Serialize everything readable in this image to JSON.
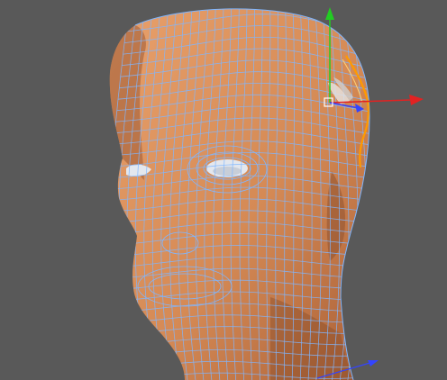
{
  "viewport": {
    "background_color": "#595959"
  },
  "model": {
    "skin_color": "#d58a55",
    "skin_shadow_color": "#a95f36",
    "skin_highlight_color": "#e8a06b",
    "wireframe_color": "#7fb6ff",
    "eye_color": "#e3e7ee",
    "selection_edge_color": "#ff9a00"
  },
  "transform_gizmo": {
    "y_axis_color": "#22cc22",
    "x_axis_color": "#e22222",
    "z_axis_color": "#3344ff",
    "y_axis_icon": "arrow-up-icon",
    "x_axis_icon": "arrow-right-icon",
    "z_axis_icon": "arrow-forward-icon"
  }
}
